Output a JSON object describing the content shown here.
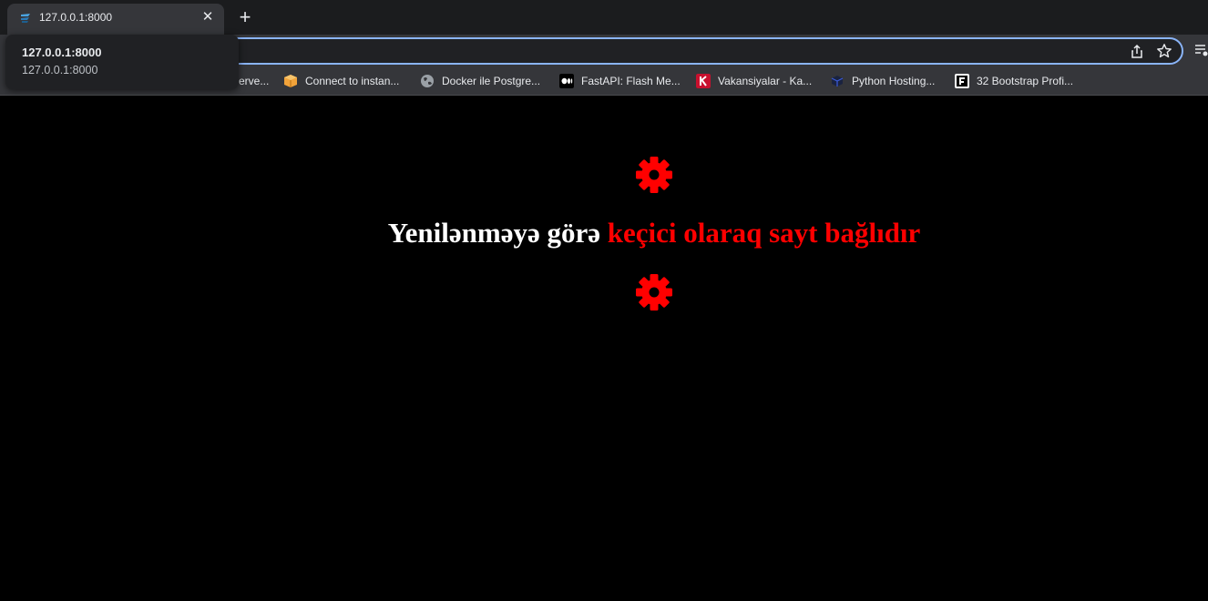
{
  "browser": {
    "tab": {
      "title": "127.0.0.1:8000"
    },
    "hover_card": {
      "title": "127.0.0.1:8000",
      "url": "127.0.0.1:8000"
    },
    "bookmarks": [
      {
        "label": "erve...",
        "icon": "partial"
      },
      {
        "label": "Connect to instan...",
        "icon": "aws-box-icon"
      },
      {
        "label": "Docker ile Postgre...",
        "icon": "globe-icon"
      },
      {
        "label": "FastAPI: Flash Me...",
        "icon": "medium-icon"
      },
      {
        "label": "Vakansiyalar - Ka...",
        "icon": "k-logo-icon"
      },
      {
        "label": "Python Hosting...",
        "icon": "python-hosting-icon"
      },
      {
        "label": "32 Bootstrap Profi...",
        "icon": "f-logo-icon"
      }
    ]
  },
  "page": {
    "message_white": "Yenilənməyə görə ",
    "message_red": "keçici olaraq sayt bağlıdır",
    "accent_color": "#ff0000",
    "icons": [
      "gear-icon",
      "gear-icon"
    ]
  }
}
